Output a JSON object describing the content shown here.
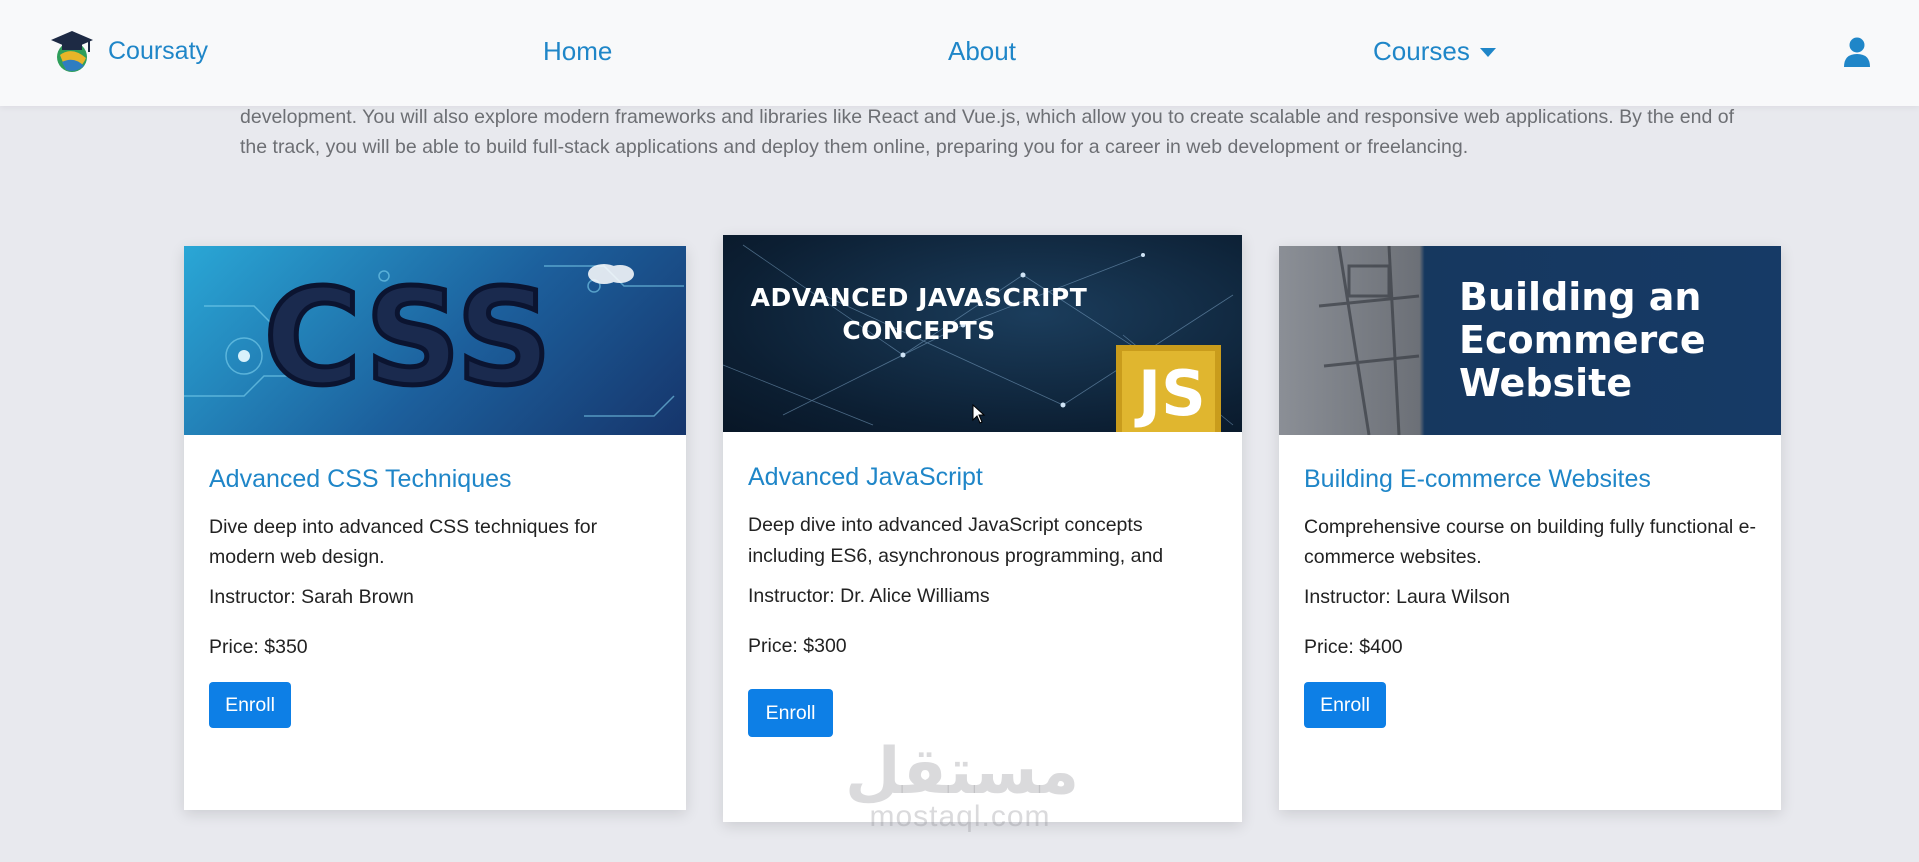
{
  "navbar": {
    "brand_name": "Coursaty",
    "links": {
      "home": "Home",
      "about": "About",
      "courses": "Courses"
    }
  },
  "track": {
    "description": "development. You will also explore modern frameworks and libraries like React and Vue.js, which allow you to create scalable and responsive web applications. By the end of the track, you will be able to build full-stack applications and deploy them online, preparing you for a career in web development or freelancing."
  },
  "courses": [
    {
      "image_text": "CSS",
      "title": "Advanced CSS Techniques",
      "description": "Dive deep into advanced CSS techniques for modern web design.",
      "instructor": "Instructor: Sarah Brown",
      "price": "Price: $350",
      "enroll_label": "Enroll"
    },
    {
      "image_text": "ADVANCED JAVASCRIPT CONCEPTS",
      "image_badge": "JS",
      "title": "Advanced JavaScript",
      "description": "Deep dive into advanced JavaScript concepts including ES6, asynchronous programming, and more.",
      "instructor": "Instructor: Dr. Alice Williams",
      "price": "Price: $300",
      "enroll_label": "Enroll"
    },
    {
      "image_text": "Building an Ecommerce Website",
      "title": "Building E-commerce Websites",
      "description": "Comprehensive course on building fully functional e-commerce websites.",
      "instructor": "Instructor: Laura Wilson",
      "price": "Price: $400",
      "enroll_label": "Enroll"
    }
  ],
  "watermark": {
    "main": "مستقل",
    "sub": "mostaql.com"
  },
  "colors": {
    "link": "#1f86c8",
    "button": "#0d7fe6",
    "page_bg": "#e8e9ee",
    "navbar_bg": "#f8f9fa"
  },
  "icons": [
    "graduation-cap-logo-icon",
    "user-icon",
    "caret-down-icon",
    "mouse-cursor-icon"
  ]
}
